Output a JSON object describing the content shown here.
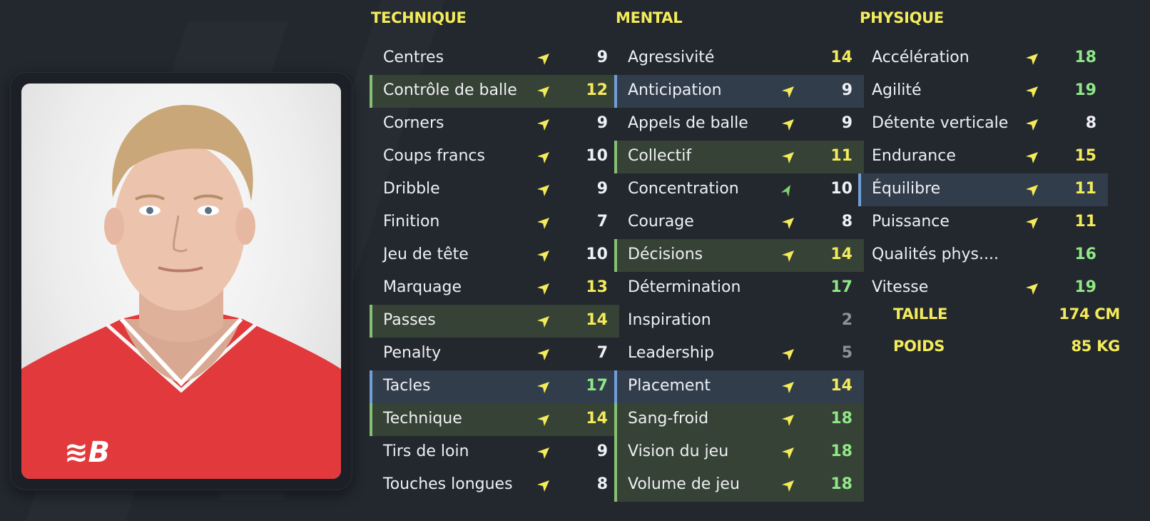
{
  "photo": {
    "alt": "player-portrait"
  },
  "colors": {
    "background": "#23272e",
    "heading": "#f3eb5a",
    "highlight_green": "#374236",
    "highlight_blue": "#323d4c",
    "arrow_yellow": "#f3eb5a",
    "arrow_green": "#7ed36a",
    "value_white": "#eef0f3",
    "value_yellow": "#f3eb5a",
    "value_green": "#8fe886",
    "value_grey": "#8d929a"
  },
  "technique": {
    "title": "TECHNIQUE",
    "rows": [
      {
        "label": "Centres",
        "value": "9",
        "tone": "white",
        "arrow": "yellow",
        "hl": ""
      },
      {
        "label": "Contrôle de balle",
        "value": "12",
        "tone": "yellow",
        "arrow": "yellow",
        "hl": "green"
      },
      {
        "label": "Corners",
        "value": "9",
        "tone": "white",
        "arrow": "yellow",
        "hl": ""
      },
      {
        "label": "Coups francs",
        "value": "10",
        "tone": "white",
        "arrow": "yellow",
        "hl": ""
      },
      {
        "label": "Dribble",
        "value": "9",
        "tone": "white",
        "arrow": "yellow",
        "hl": ""
      },
      {
        "label": "Finition",
        "value": "7",
        "tone": "white",
        "arrow": "yellow",
        "hl": ""
      },
      {
        "label": "Jeu de tête",
        "value": "10",
        "tone": "white",
        "arrow": "yellow",
        "hl": ""
      },
      {
        "label": "Marquage",
        "value": "13",
        "tone": "yellow",
        "arrow": "yellow",
        "hl": ""
      },
      {
        "label": "Passes",
        "value": "14",
        "tone": "yellow",
        "arrow": "yellow",
        "hl": "green"
      },
      {
        "label": "Penalty",
        "value": "7",
        "tone": "white",
        "arrow": "yellow",
        "hl": ""
      },
      {
        "label": "Tacles",
        "value": "17",
        "tone": "green",
        "arrow": "yellow",
        "hl": "blue"
      },
      {
        "label": "Technique",
        "value": "14",
        "tone": "yellow",
        "arrow": "yellow",
        "hl": "green"
      },
      {
        "label": "Tirs de loin",
        "value": "9",
        "tone": "white",
        "arrow": "yellow",
        "hl": ""
      },
      {
        "label": "Touches longues",
        "value": "8",
        "tone": "white",
        "arrow": "yellow",
        "hl": ""
      }
    ]
  },
  "mental": {
    "title": "MENTAL",
    "rows": [
      {
        "label": "Agressivité",
        "value": "14",
        "tone": "yellow",
        "arrow": "",
        "hl": ""
      },
      {
        "label": "Anticipation",
        "value": "9",
        "tone": "white",
        "arrow": "yellow",
        "hl": "blue"
      },
      {
        "label": "Appels de balle",
        "value": "9",
        "tone": "white",
        "arrow": "yellow",
        "hl": ""
      },
      {
        "label": "Collectif",
        "value": "11",
        "tone": "yellow",
        "arrow": "yellow",
        "hl": "green"
      },
      {
        "label": "Concentration",
        "value": "10",
        "tone": "white",
        "arrow": "green",
        "hl": ""
      },
      {
        "label": "Courage",
        "value": "8",
        "tone": "white",
        "arrow": "yellow",
        "hl": ""
      },
      {
        "label": "Décisions",
        "value": "14",
        "tone": "yellow",
        "arrow": "yellow",
        "hl": "green"
      },
      {
        "label": "Détermination",
        "value": "17",
        "tone": "green",
        "arrow": "",
        "hl": ""
      },
      {
        "label": "Inspiration",
        "value": "2",
        "tone": "grey",
        "arrow": "",
        "hl": ""
      },
      {
        "label": "Leadership",
        "value": "5",
        "tone": "grey",
        "arrow": "yellow",
        "hl": ""
      },
      {
        "label": "Placement",
        "value": "14",
        "tone": "yellow",
        "arrow": "yellow",
        "hl": "blue"
      },
      {
        "label": "Sang-froid",
        "value": "18",
        "tone": "green",
        "arrow": "yellow",
        "hl": "green"
      },
      {
        "label": "Vision du jeu",
        "value": "18",
        "tone": "green",
        "arrow": "yellow",
        "hl": "green"
      },
      {
        "label": "Volume de jeu",
        "value": "18",
        "tone": "green",
        "arrow": "yellow",
        "hl": "green"
      }
    ]
  },
  "physique": {
    "title": "PHYSIQUE",
    "rows": [
      {
        "label": "Accélération",
        "value": "18",
        "tone": "green",
        "arrow": "yellow",
        "hl": ""
      },
      {
        "label": "Agilité",
        "value": "19",
        "tone": "green",
        "arrow": "yellow",
        "hl": ""
      },
      {
        "label": "Détente verticale",
        "value": "8",
        "tone": "white",
        "arrow": "yellow",
        "hl": ""
      },
      {
        "label": "Endurance",
        "value": "15",
        "tone": "yellow",
        "arrow": "yellow",
        "hl": ""
      },
      {
        "label": "Équilibre",
        "value": "11",
        "tone": "yellow",
        "arrow": "yellow",
        "hl": "blue"
      },
      {
        "label": "Puissance",
        "value": "11",
        "tone": "yellow",
        "arrow": "yellow",
        "hl": ""
      },
      {
        "label": "Qualités phys....",
        "value": "16",
        "tone": "green",
        "arrow": "",
        "hl": ""
      },
      {
        "label": "Vitesse",
        "value": "19",
        "tone": "green",
        "arrow": "yellow",
        "hl": ""
      }
    ]
  },
  "meta": {
    "height_label": "TAILLE",
    "height_value": "174 CM",
    "weight_label": "POIDS",
    "weight_value": "85 KG"
  }
}
